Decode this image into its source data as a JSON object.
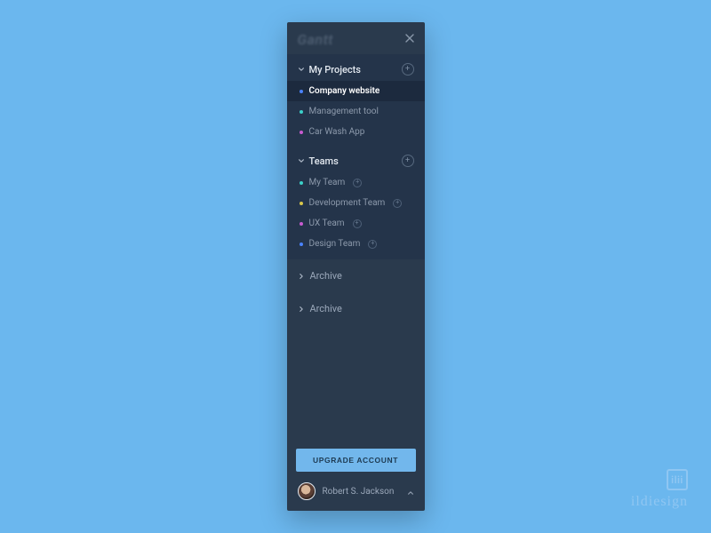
{
  "header": {
    "logo": "Gantt"
  },
  "sections": {
    "projects": {
      "title": "My Projects",
      "items": [
        {
          "label": "Company website",
          "dot_color": "#4a83ff",
          "active": true
        },
        {
          "label": "Management tool",
          "dot_color": "#3bd1c9",
          "active": false
        },
        {
          "label": "Car Wash App",
          "dot_color": "#c85bd1",
          "active": false
        }
      ]
    },
    "teams": {
      "title": "Teams",
      "items": [
        {
          "label": "My Team",
          "dot_color": "#3bd1c9"
        },
        {
          "label": "Development Team",
          "dot_color": "#d8c64a"
        },
        {
          "label": "UX Team",
          "dot_color": "#c85bd1"
        },
        {
          "label": "Design Team",
          "dot_color": "#4a83ff"
        }
      ]
    },
    "archive1": {
      "title": "Archive"
    },
    "archive2": {
      "title": "Archive"
    }
  },
  "footer": {
    "upgrade_label": "UPGRADE ACCOUNT",
    "user_name": "Robert S. Jackson"
  },
  "watermark": {
    "box": "ilii",
    "text": "ildiesign"
  }
}
